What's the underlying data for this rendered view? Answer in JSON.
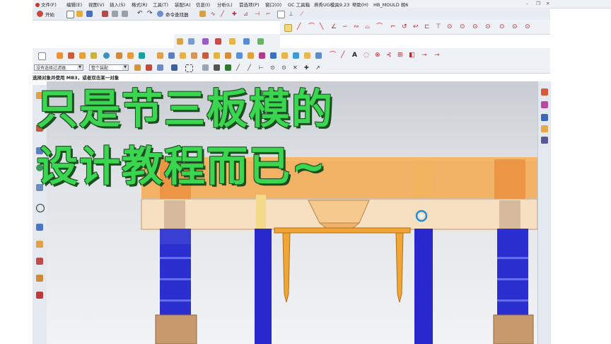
{
  "menu": {
    "items": [
      "文件(F)",
      "编辑(E)",
      "视图(V)",
      "插入(S)",
      "格式(R)",
      "工具(T)",
      "装配(A)",
      "信息(I)",
      "分析(L)",
      "首选项(P)",
      "窗口(O)",
      "GC 工具箱",
      "燕秀UG模具9.23",
      "帮助(H)",
      "HB_MOULD 胡6"
    ]
  },
  "toolbar": {
    "start_label": "开始",
    "command_finder_label": "命令查找器"
  },
  "selection": {
    "filter_value": "没有选择过滤器",
    "scope_value": "整个装配"
  },
  "status": {
    "prompt": "选择对象并使用 MB3，或者双击某一对象"
  },
  "overlay": {
    "line1": "只是节三板模的",
    "line2": "设计教程而已~"
  },
  "colors": {
    "accent_green": "#3ad64f",
    "pillar_blue": "#2b2fd0",
    "plate_orange": "#f4a94e",
    "pin_orange": "#f0a534"
  }
}
